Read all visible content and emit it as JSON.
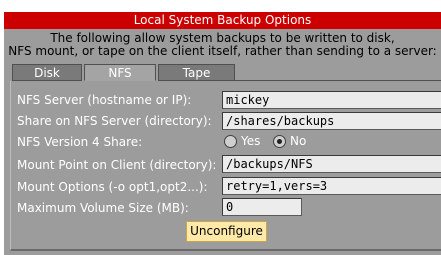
{
  "window": {
    "title": "Local System Backup Options",
    "description_line1": "The following allow system backups to be written to disk,",
    "description_line2": "NFS mount, or tape on the client itself, rather than sending to a server:"
  },
  "tabs": [
    {
      "label": "Disk",
      "active": false
    },
    {
      "label": "NFS",
      "active": true
    },
    {
      "label": "Tape",
      "active": false
    }
  ],
  "form": {
    "nfs_server_label": "NFS Server (hostname or IP):",
    "nfs_server_value": "mickey",
    "share_label": "Share on NFS Server (directory):",
    "share_value": "/shares/backups",
    "nfs_v4_label": "NFS Version 4 Share:",
    "nfs_v4_yes": "Yes",
    "nfs_v4_no": "No",
    "nfs_v4_selected": "No",
    "mount_point_label": "Mount Point on Client (directory):",
    "mount_point_value": "/backups/NFS",
    "mount_options_label": "Mount Options (-o opt1,opt2...):",
    "mount_options_value": "retry=1,vers=3",
    "max_volume_label": "Maximum Volume Size (MB):",
    "max_volume_value": "0"
  },
  "actions": {
    "unconfigure_label": "Unconfigure"
  },
  "colors": {
    "title_bar": "#cc0000",
    "panel": "#9c9c9c",
    "button": "#ffe9a8"
  }
}
